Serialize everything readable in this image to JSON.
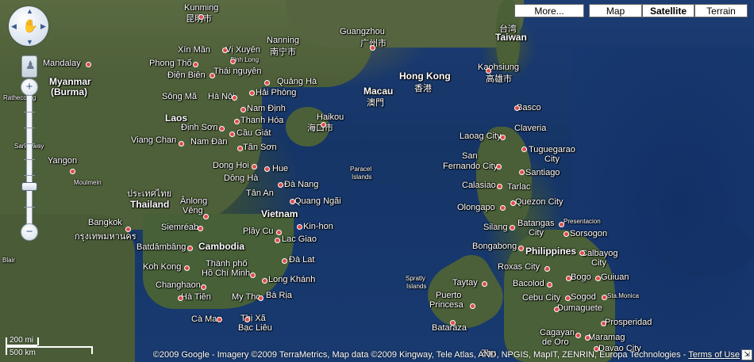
{
  "map_types": {
    "more": "More...",
    "map": "Map",
    "satellite": "Satellite",
    "terrain": "Terrain"
  },
  "zoom": {
    "in": "+",
    "out": "−",
    "level": 0.28
  },
  "scale": {
    "miles": "200 mi",
    "km": "500 km"
  },
  "attribution": "©2009 Google - Imagery ©2009 TerraMetrics, Map data ©2009 Kingway, Tele Atlas, AND, NPGIS, MapIT, ZENRIN, Europa Technologies -",
  "terms": "Terms of Use",
  "labels": {
    "kunming": "Kunming",
    "kunming_cn": "昆明市",
    "mandalay": "Mandalay",
    "myanmar": "Myanmar",
    "burma": "(Burma)",
    "xinman": "Xín Mần",
    "vixuyen": "Vị Xuyên",
    "sinhlong": "Sinh Long",
    "nanning": "Nanning",
    "nanning_cn": "南宁市",
    "guangzhou": "Guangzhou",
    "guangzhou_cn": "广州市",
    "taiwan_cn": "台湾",
    "taiwan": "Taiwan",
    "kaohsiung": "Kaohsiung",
    "kaohsiung_cn": "高雄市",
    "phongtho": "Phong Thổ",
    "dienbien": "Điện Biên",
    "thainguyen": "Thái nguyên",
    "quangha": "Quảng Hà",
    "haiphong": "Hải Phòng",
    "macau": "Macau",
    "macau_cn": "澳門",
    "hongkong": "Hong Kong",
    "hongkong_cn": "香港",
    "rathecourg": "Rathecourg",
    "songma": "Sông Mã",
    "hanoi": "Hà Nội",
    "namdinh": "Nam Định",
    "thanhhoa": "Thanh Hóa",
    "haikou": "Haikou",
    "haikou_cn": "海口市",
    "basco": "Basco",
    "laos": "Laos",
    "dinhson": "Định Sơn",
    "caugiat": "Cầu Giát",
    "claveria": "Claveria",
    "viangchan": "Viang Chan",
    "namdan": "Nam Đàn",
    "tanson": "Tân Sơn",
    "laoagcity": "Laoag City",
    "tuguegarao": "Tuguegarao",
    "city": "City",
    "sangaway": "Sangaway",
    "san": "San",
    "fernandocity": "Fernando City",
    "santiago": "Santiago",
    "yangon": "Yangon",
    "donghoi": "Dong Hoi",
    "hue": "Hue",
    "paracel": "Paracel",
    "islands": "Islands",
    "moulmein": "Moulmein",
    "dongha": "Dông Hà",
    "danang": "Đà Nang",
    "calasiao": "Calasiao",
    "tarlac": "Tarlac",
    "thai_script": "ประเทศไทย",
    "thailand": "Thailand",
    "anlong": "Ânlong",
    "veng": "Vêng",
    "tanan": "Tân An",
    "quangngai": "Quang Ngãi",
    "vietnam": "Vietnam",
    "olongapo": "Olongapo",
    "quezoncity": "Quezon City",
    "bangkok": "Bangkok",
    "bangkok_th": "กรุงเทพมหานคร",
    "siemreab": "Siemréab",
    "kinhon": "Kin-hon",
    "playcu": "Plây Cu",
    "presentacion": "Presentacion",
    "silang": "Silang",
    "batangas": "Batangas",
    "sorsogon": "Sorsogon",
    "batdambang": "Batdâmbâng",
    "cambodia": "Cambodia",
    "lacgiao": "Lac Giao",
    "bongabong": "Bongabong",
    "philippines": "Philippines",
    "calbayog": "Calbayog",
    "blair": "Blair",
    "kohkong": "Koh Kong",
    "thanhpho": "Thành phố",
    "hochiminh": "Hồ Chí Minh",
    "dalat": "Đà Lat",
    "roxascity": "Roxas City",
    "spratly": "Spratly",
    "bogo": "Bogo",
    "guiuan": "Guiuan",
    "changhaon": "Changhaon",
    "longkhanh": "Long Khánh",
    "taytay": "Taytay",
    "bacolod": "Bacolod",
    "hatien": "Hà Tiên",
    "mytho": "My Tho",
    "baria": "Bà Rịa",
    "puerto": "Puerto",
    "princesa": "Princesa",
    "cebucity": "Cebu City",
    "sogod": "Sogod",
    "stamonica": "Sta.Monica",
    "dumaguete": "Dumaguete",
    "camau": "Cà Mau",
    "thixa": "Thị Xã",
    "baclieu": "Bạc Liêu",
    "bataraza": "Bataraza",
    "prosperidad": "Prosperidad",
    "cagayan": "Cagayan",
    "deoro": "de Oro",
    "maramag": "Maramag",
    "davaocity": "Davao City",
    "zhu": "Zhu"
  }
}
